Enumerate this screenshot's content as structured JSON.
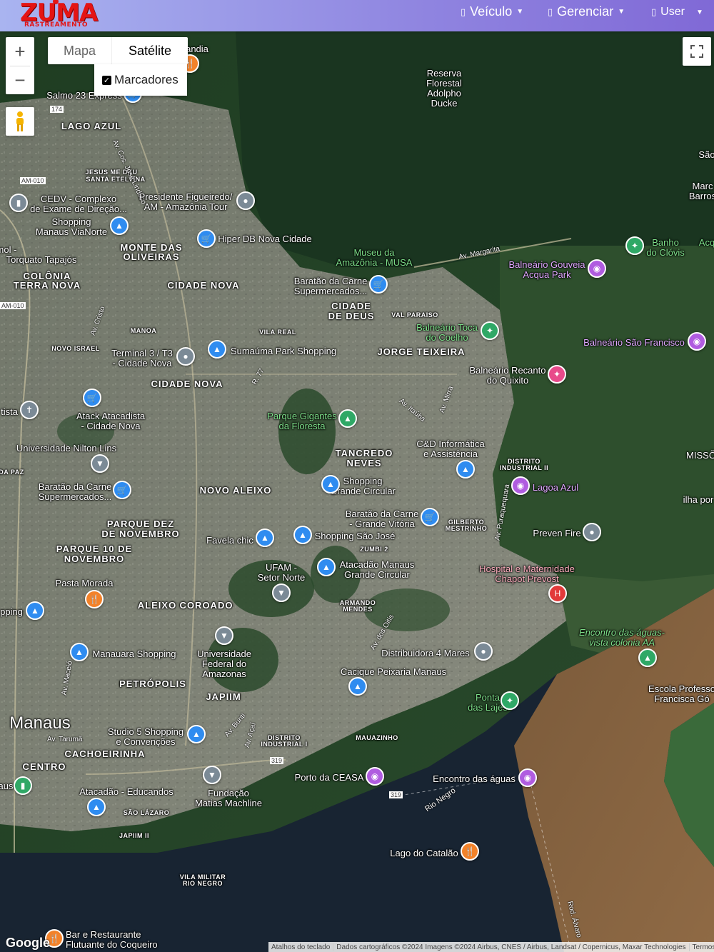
{
  "brand": {
    "name": "ZUMA",
    "tagline": "RASTREAMENTO",
    "color": "#e41414"
  },
  "navbar": {
    "items": [
      {
        "label": "Veículo",
        "icon": "car-icon"
      },
      {
        "label": "Gerenciar",
        "icon": "settings-icon"
      },
      {
        "label": "User",
        "icon": "user-icon"
      }
    ]
  },
  "map": {
    "zoom_in": "+",
    "zoom_out": "−",
    "type_map": "Mapa",
    "type_satellite": "Satélite",
    "markers_label": "Marcadores",
    "markers_checked": true,
    "google_logo": "Google",
    "attribution": {
      "keyboard": "Atalhos do teclado",
      "data": "Dados cartográficos ©2024 Imagens ©2024 Airbus, CNES / Airbus, Landsat / Copernicus, Maxar Technologies",
      "terms": "Termos"
    },
    "areas": {
      "lago_azul": "LAGO AZUL",
      "jesus_me_deu": "JESUS ME DEU",
      "santa_etelvina": "SANTA ETELVINA",
      "monte_das_oliveiras_1": "MONTE DAS",
      "monte_das_oliveiras_2": "OLIVEIRAS",
      "colonia_1": "COLÔNIA",
      "colonia_2": "TERRA NOVA",
      "cidade_nova_1": "CIDADE NOVA",
      "cidade_de_deus_1": "CIDADE",
      "cidade_de_deus_2": "DE DEUS",
      "val_paraiso": "VAL PARAISO",
      "manoa": "MANOA",
      "vila_real": "VILA REAL",
      "novo_israel": "NOVO ISRAEL",
      "jorge_teixeira": "JORGE TEIXEIRA",
      "cidade_nova_2": "CIDADE NOVA",
      "tancredo_1": "TANCREDO",
      "tancredo_2": "NEVES",
      "distrito_1": "DISTRITO",
      "distrito_2": "INDUSTRIAL II",
      "novo_aleixo": "NOVO ALEIXO",
      "parque_dez_1": "PARQUE DEZ",
      "parque_dez_2": "DE NOVEMBRO",
      "parque_10_1": "PARQUE 10 DE",
      "parque_10_2": "NOVEMBRO",
      "gilberto_1": "GILBERTO",
      "gilberto_2": "MESTRINHO",
      "zumbi": "ZUMBI 2",
      "armando_1": "ARMANDO",
      "armando_2": "MENDES",
      "aleixo": "ALEIXO",
      "coroado": "COROADO",
      "petropolis": "PETRÓPOLIS",
      "japiim": "JAPIIM",
      "manaus": "Manaus",
      "cachoeirinha": "CACHOEIRINHA",
      "centro": "CENTRO",
      "distrito_i_1": "DISTRITO",
      "distrito_i_2": "INDUSTRIAL I",
      "mauazinho": "MAUAZINHO",
      "sao_lazaro": "SÃO LÁZARO",
      "japiim_ii": "JAPIIM II",
      "vila_militar_1": "VILA MILITAR",
      "vila_militar_2": "RIO NEGRO"
    },
    "roads": {
      "am010_a": "AM-010",
      "am010_b": "AM-010",
      "r174": "174",
      "r319_a": "319",
      "r319_b": "319",
      "av_cosme": "Av. Cos. José Lindoso",
      "av_margarita": "Av. Margarita",
      "av_cristo": "Av. Cristo",
      "av_itauba": "Av. Itaúba",
      "av_mirra": "Av. Mirra",
      "r77": "R. 77",
      "av_puraquequara": "Av. Puraquequara",
      "av_dos_oitis": "Av. dos Oitis",
      "av_buriti": "Av. Buriti",
      "av_acai": "Av. Açaí",
      "av_maceio": "Av. Maceió",
      "av_taruma": "Av. Tarumã",
      "rio_negro": "Rio Negro",
      "rod_alvaro": "Rod. Álvaro"
    },
    "places": {
      "reserva_1": "Reserva",
      "reserva_2": "Florestal",
      "reserva_3": "Adolpho",
      "reserva_4": "Ducke",
      "sao": "São",
      "marc_1": "Marc",
      "marc_2": "Barros",
      "andia": "andia",
      "salmo": "Salmo 23 Express",
      "cedv_1": "CEDV - Complexo",
      "cedv_2": "de Exame de Direção...",
      "presidente_1": "Presidente Figueiredo/",
      "presidente_2": "AM - Amazônia Tour",
      "shopping_via_1": "Shopping",
      "shopping_via_2": "Manaus ViaNorte",
      "hiper_db": "Hiper DB Nova Cidade",
      "bemol_1": "Bemol -",
      "bemol_2": "Torquato Tapajós",
      "museu_1": "Museu da",
      "museu_2": "Amazônia - MUSA",
      "banho_1": "Banho",
      "banho_2": "do Clóvis",
      "acq": "Acq",
      "gouveia_1": "Balneário Gouveia",
      "gouveia_2": "Acqua Park",
      "baratao1_1": "Baratão da Carne",
      "baratao1_2": "Supermercados...",
      "toca_1": "Balneário Toca",
      "toca_2": "do Coelho",
      "sao_francisco": "Balneário São Francisco",
      "terminal_1": "Terminal 3 / T3",
      "terminal_2": "- Cidade Nova",
      "sumauma": "Sumaúma Park Shopping",
      "recanto_1": "Balneário Recanto",
      "recanto_2": "do Quixito",
      "tista": "tista",
      "atack_1": "Atack Atacadista",
      "atack_2": "- Cidade Nova",
      "gigantes_1": "Parque Gigantes",
      "gigantes_2": "da Floresta",
      "nilton": "Universidade Nilton Lins",
      "cd_1": "C&D Informática",
      "cd_2": "e Assistência",
      "misso": "MISSÕ",
      "da_paz": "DA PAZ",
      "baratao2_1": "Baratão da Carne",
      "baratao2_2": "Supermercados...",
      "sgc_1": "Shopping",
      "sgc_2": "Grande Circular",
      "lagoa_azul": "Lagoa Azul",
      "ilha": "ilha por",
      "baratao3_1": "Baratão da Carne",
      "baratao3_2": "- Grande Vitória",
      "favela": "Favela chic",
      "shopping_sj": "Shopping São José",
      "preven": "Preven Fire",
      "ufam_norte_1": "UFAM -",
      "ufam_norte_2": "Setor Norte",
      "atacadao_gc_1": "Atacadão Manaus",
      "atacadao_gc_2": "Grande Circular",
      "hospital_1": "Hospital e Maternidade",
      "hospital_2": "Chapot Prevost",
      "pasta": "Pasta Morada",
      "pping": "pping",
      "encontro_vista_1": "Encontro das águas-",
      "encontro_vista_2": "vista colonia AA",
      "manauara": "Manauara Shopping",
      "ufam_1": "Universidade",
      "ufam_2": "Federal do",
      "ufam_3": "Amazonas",
      "distribuidora": "Distribuidora 4 Mares",
      "cacique": "Cacique Peixaria Manaus",
      "escola_1": "Escola Professo",
      "escola_2": "Francisca Gó",
      "ponta_1": "Ponta",
      "ponta_2": "das Lajes",
      "studio_1": "Studio 5 Shopping",
      "studio_2": "e Convenções",
      "porto": "Porto da CEASA",
      "encontro": "Encontro das águas",
      "atacadao_ed": "Atacadão - Educandos",
      "fundacao_1": "Fundação",
      "fundacao_2": "Matias Machline",
      "aus": "aus",
      "catalao": "Lago do Catalão",
      "bar_1": "Bar e Restaurante",
      "bar_2": "Flutuante do Coqueiro"
    }
  }
}
